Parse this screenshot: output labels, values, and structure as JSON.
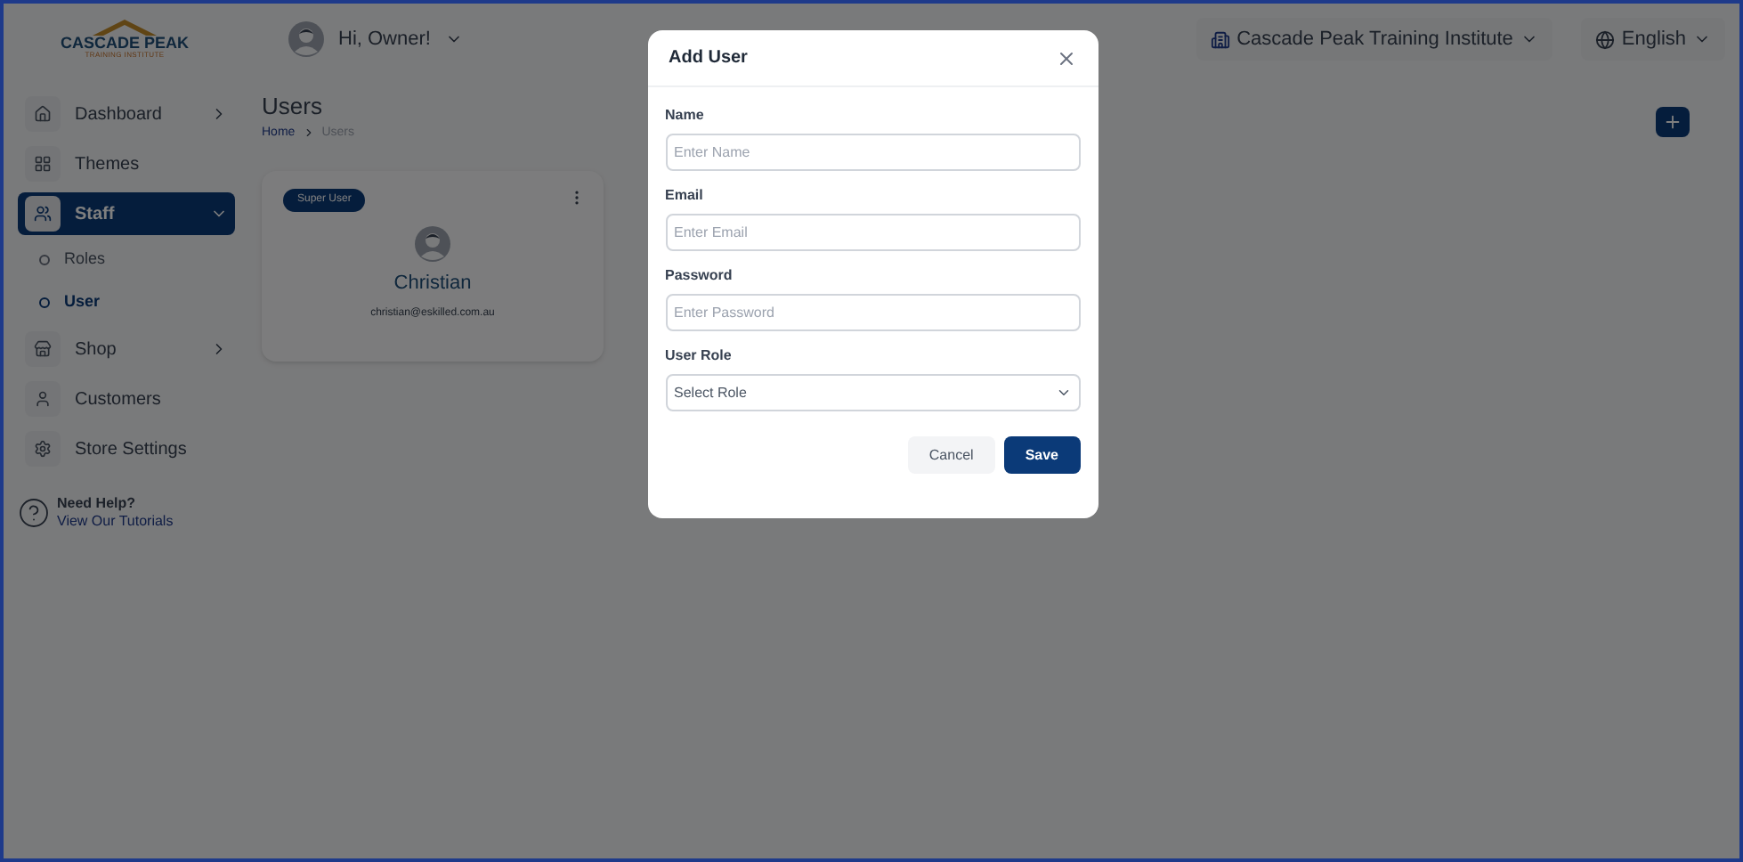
{
  "logo": {
    "name": "CASCADE PEAK",
    "tagline": "TRAINING INSTITUTE"
  },
  "header": {
    "greeting": "Hi, Owner!",
    "institute": "Cascade Peak Training Institute",
    "language": "English"
  },
  "sidebar": {
    "items": [
      {
        "label": "Dashboard",
        "selected": false,
        "expanded": false
      },
      {
        "label": "Themes",
        "selected": false
      },
      {
        "label": "Staff",
        "selected": true,
        "expanded": true,
        "children": [
          {
            "label": "Roles",
            "selected": false
          },
          {
            "label": "User",
            "selected": true
          }
        ]
      },
      {
        "label": "Shop",
        "selected": false,
        "expanded": false
      },
      {
        "label": "Customers",
        "selected": false
      },
      {
        "label": "Store Settings",
        "selected": false
      }
    ],
    "help": {
      "title": "Need Help?",
      "link": "View Our Tutorials"
    }
  },
  "page": {
    "title": "Users",
    "breadcrumb": [
      "Home",
      "Users"
    ],
    "cards": [
      {
        "badge": "Super User",
        "name": "Christian",
        "email": "christian@eskilled.com.au"
      }
    ]
  },
  "dialog": {
    "title": "Add User",
    "fields": [
      {
        "kind": "input",
        "label": "Name",
        "placeholder": "Enter Name"
      },
      {
        "kind": "input",
        "label": "Email",
        "placeholder": "Enter Email"
      },
      {
        "kind": "input",
        "label": "Password",
        "placeholder": "Enter Password"
      },
      {
        "kind": "select",
        "label": "User Role",
        "placeholder": "Select Role"
      }
    ],
    "buttons": [
      {
        "label": "Cancel",
        "kind": "secondary"
      },
      {
        "label": "Save",
        "kind": "primary"
      }
    ]
  }
}
